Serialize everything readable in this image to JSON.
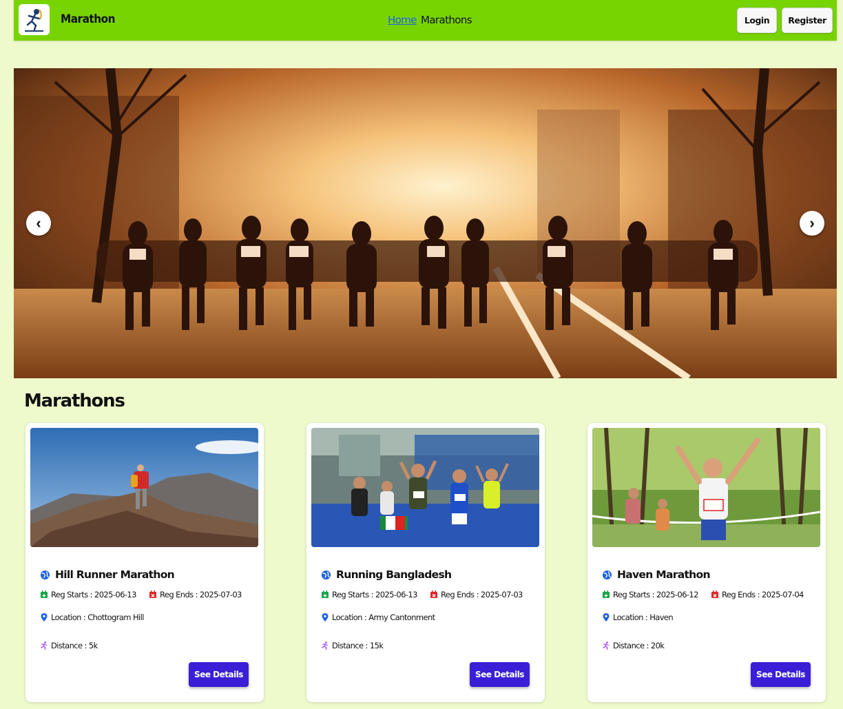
{
  "navbar": {
    "brand": "Marathon",
    "links": [
      {
        "label": "Home",
        "active": true
      },
      {
        "label": "Marathons",
        "active": false
      }
    ],
    "login_label": "Login",
    "register_label": "Register"
  },
  "hero": {
    "prev_label": "‹",
    "next_label": "›"
  },
  "section": {
    "title": "Marathons"
  },
  "marathons": [
    {
      "title": "Hill Runner Marathon",
      "reg_starts": "Reg Starts : 2025-06-13",
      "reg_ends": "Reg Ends : 2025-07-03",
      "location": "Location : Chottogram Hill",
      "distance": "Distance : 5k",
      "button": "See Details"
    },
    {
      "title": "Running Bangladesh",
      "reg_starts": "Reg Starts : 2025-06-13",
      "reg_ends": "Reg Ends : 2025-07-03",
      "location": "Location : Army Cantonment",
      "distance": "Distance : 15k",
      "button": "See Details"
    },
    {
      "title": "Haven Marathon",
      "reg_starts": "Reg Starts : 2025-06-12",
      "reg_ends": "Reg Ends : 2025-07-04",
      "location": "Location : Haven",
      "distance": "Distance : 20k",
      "button": "See Details"
    }
  ],
  "colors": {
    "page_bg": "#eefacb",
    "navbar_bg": "#78d400",
    "button_primary": "#3b1fd6",
    "icon_globe": "#1f63e0",
    "icon_reg_start": "#16a34a",
    "icon_reg_end": "#dc2626",
    "icon_location": "#1f63e0",
    "icon_distance": "#a855f7"
  }
}
